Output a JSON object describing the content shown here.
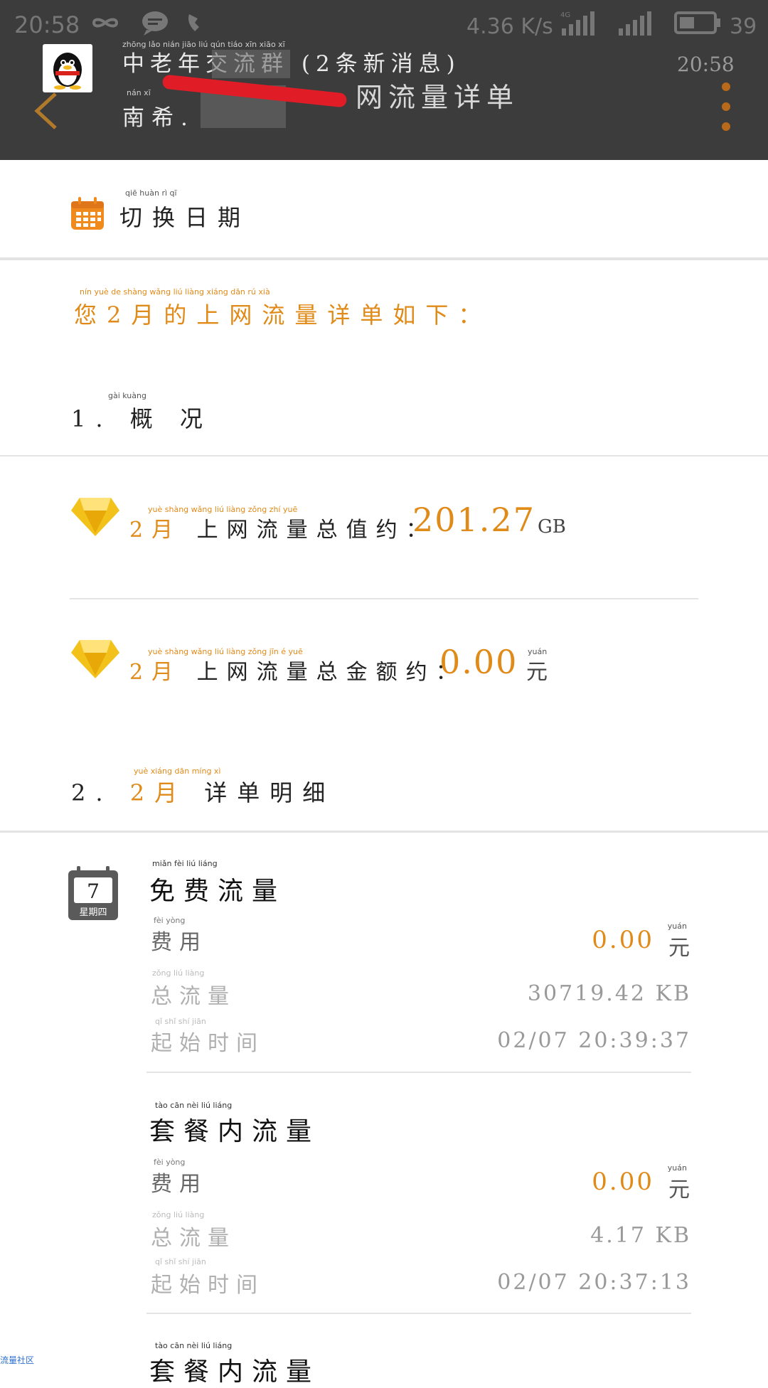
{
  "status_bar": {
    "time": "20:58",
    "net_speed": "4.36 K/s",
    "network": "4G",
    "battery": "39",
    "icons": [
      "infinity-icon",
      "chat-bubble-icon",
      "phone-icon",
      "signal-icon",
      "signal-icon",
      "battery-icon"
    ]
  },
  "notification": {
    "title": "中老年交流群 (2条新消息)",
    "sender": "南希.",
    "time": "20:58",
    "title_pinyin": "zhōng  lǎo  nián            jiāo  liú  qún   tiáo  xīn  xiāo  xī",
    "sender_pinyin": "nán  xī"
  },
  "app_bar": {
    "title": "网流量详单",
    "back_icon": "back-arrow-icon",
    "menu_icon": "more-dots-icon"
  },
  "switch_date": {
    "label": "切换日期",
    "label_pinyin": "qiē  huàn  rì  qī",
    "icon": "calendar-icon"
  },
  "headline": {
    "text": "您2月的上网流量详单如下：",
    "pinyin": "nín   yuè   de  shàng wǎng  liú  liàng xiáng dān  rú  xià"
  },
  "overview": {
    "heading": "1. 概 况",
    "heading_pinyin": "gài   kuàng",
    "usage": {
      "month": "2月",
      "label": "上网流量总值约：",
      "value": "201.27",
      "unit": "GB",
      "pinyin": "yuè     shàng wǎng  liú  liàng zǒng  zhí   yuē"
    },
    "amount": {
      "month": "2月",
      "label": "上网流量总金额约：",
      "value": "0.00",
      "unit": "元",
      "pinyin": "yuè     shàng wǎng  liú  liàng zǒng  jīn    é    yuē",
      "unit_pinyin": "yuán"
    }
  },
  "details": {
    "heading_prefix": "2.",
    "heading_month": "2月",
    "heading_label": "详单明细",
    "heading_pinyin": "yuè        xiáng  dān  míng  xì",
    "day_badge": {
      "day": "7",
      "weekday": "星期四"
    },
    "labels": {
      "fee": "费用",
      "total": "总流量",
      "start_time": "起始时间",
      "fee_pinyin": "fèi  yòng",
      "total_pinyin": "zǒng  liú  liàng",
      "start_pinyin": "qǐ   shǐ   shí   jiān",
      "unit_pinyin": "yuán"
    },
    "items": [
      {
        "title": "免费流量",
        "title_pinyin": "miǎn   fèi    liú   liáng",
        "fee": "0.00",
        "fee_unit": "元",
        "total": "30719.42 KB",
        "start_time": "02/07  20:39:37"
      },
      {
        "title": "套餐内流量",
        "title_pinyin": "tào   cān   nèi   liú   liáng",
        "fee": "0.00",
        "fee_unit": "元",
        "total": "4.17 KB",
        "start_time": "02/07  20:37:13"
      },
      {
        "title": "套餐内流量",
        "title_pinyin": "tào   cān   nèi   liú   liáng"
      }
    ]
  },
  "watermark": "流量社区",
  "colors": {
    "accent": "#e08a18",
    "overlay": "#3c3c3c",
    "redaction": "#e01d26"
  }
}
